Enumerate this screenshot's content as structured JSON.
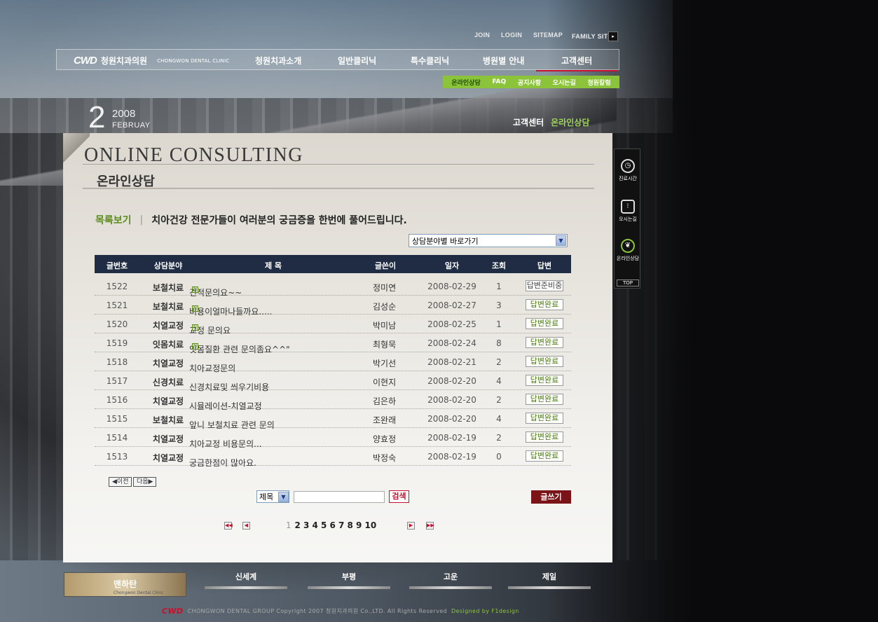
{
  "top_links": [
    "JOIN",
    "LOGIN",
    "SITEMAP",
    "FAMILY SITE"
  ],
  "logo": {
    "mark": "CWD",
    "name_kr": "청원치과의원",
    "name_en": "CHONGWON DENTAL CLINIC"
  },
  "main_menu": [
    "청원치과소개",
    "일반클리닉",
    "특수클리닉",
    "병원별 안내",
    "고객센터"
  ],
  "sub_menu": [
    "온라인상담",
    "FAQ",
    "공지사항",
    "오시는길",
    "청원칼럼"
  ],
  "date": {
    "day": "2",
    "year": "2008",
    "month": "FEBRUAY"
  },
  "breadcrumb": {
    "section": "고객센터",
    "current": "온라인상담"
  },
  "page": {
    "title_en": "ONLINE CONSULTING",
    "title_kr": "온라인상담"
  },
  "list_header": {
    "label": "목록보기",
    "sep": "|",
    "desc": "치아건강 전문가들이 여러분의 궁금증을 한번에 풀어드립니다."
  },
  "category_select": {
    "value": "상담분야별 바로가기"
  },
  "table": {
    "headers": [
      "글번호",
      "상담분야",
      "제 목",
      "글쓴이",
      "일자",
      "조회",
      "답변"
    ],
    "rows": [
      {
        "no": "1522",
        "cat": "보철치료",
        "title": "견적문의요~~",
        "new": true,
        "author": "정미연",
        "date": "2008-02-29",
        "hits": "1",
        "status": "답변준비중",
        "done": false
      },
      {
        "no": "1521",
        "cat": "보철치료",
        "title": "비용이얼마나들까요.....",
        "new": true,
        "author": "김성순",
        "date": "2008-02-27",
        "hits": "3",
        "status": "답변완료",
        "done": true
      },
      {
        "no": "1520",
        "cat": "치열교정",
        "title": "교정 문의요",
        "new": true,
        "author": "박미남",
        "date": "2008-02-25",
        "hits": "1",
        "status": "답변완료",
        "done": true
      },
      {
        "no": "1519",
        "cat": "잇몸치료",
        "title": "잇몸질환 관련 문의좀요^^\"",
        "new": true,
        "author": "최형묵",
        "date": "2008-02-24",
        "hits": "8",
        "status": "답변완료",
        "done": true
      },
      {
        "no": "1518",
        "cat": "치열교정",
        "title": "치아교정문의",
        "new": false,
        "author": "박기선",
        "date": "2008-02-21",
        "hits": "2",
        "status": "답변완료",
        "done": true
      },
      {
        "no": "1517",
        "cat": "신경치료",
        "title": "신경치료및 씌우기비용",
        "new": false,
        "author": "이현지",
        "date": "2008-02-20",
        "hits": "4",
        "status": "답변완료",
        "done": true
      },
      {
        "no": "1516",
        "cat": "치열교정",
        "title": "시뮬레이션-치열교정",
        "new": false,
        "author": "김은하",
        "date": "2008-02-20",
        "hits": "2",
        "status": "답변완료",
        "done": true
      },
      {
        "no": "1515",
        "cat": "보철치료",
        "title": "앞니 보철치료 관련 문의",
        "new": false,
        "author": "조완래",
        "date": "2008-02-20",
        "hits": "4",
        "status": "답변완료",
        "done": true
      },
      {
        "no": "1514",
        "cat": "치열교정",
        "title": "치아교정 비용문의...",
        "new": false,
        "author": "양효정",
        "date": "2008-02-19",
        "hits": "2",
        "status": "답변완료",
        "done": true
      },
      {
        "no": "1513",
        "cat": "치열교정",
        "title": "궁금한점이 많아요.",
        "new": false,
        "author": "박정숙",
        "date": "2008-02-19",
        "hits": "0",
        "status": "답변완료",
        "done": true
      }
    ]
  },
  "new_badge": "N",
  "prev_label": "◀이전",
  "next_label": "다음▶",
  "search": {
    "field": "제목",
    "placeholder": "",
    "button": "검색"
  },
  "write_button": "글쓰기",
  "pagination": {
    "pages": [
      "1",
      "2",
      "3",
      "4",
      "5",
      "6",
      "7",
      "8",
      "9",
      "10"
    ],
    "current": "1",
    "first": "◀◀",
    "prev": "◀",
    "next": "▶",
    "last": "▶▶"
  },
  "quick_menu": [
    "진료시간",
    "오시는길",
    "온라인상담"
  ],
  "top_button": "TOP",
  "footer": {
    "thumb_title": "맨하탄",
    "thumb_sub": "Chongwon Dental Clinic",
    "branches": [
      "신세계",
      "부평",
      "고운",
      "제일"
    ],
    "copyright": "CHONGWON DENTAL GROUP Copyright 2007 청원치과의원 Co.,LTD. All Rights Reserved",
    "designed": "Designed by F1design"
  }
}
